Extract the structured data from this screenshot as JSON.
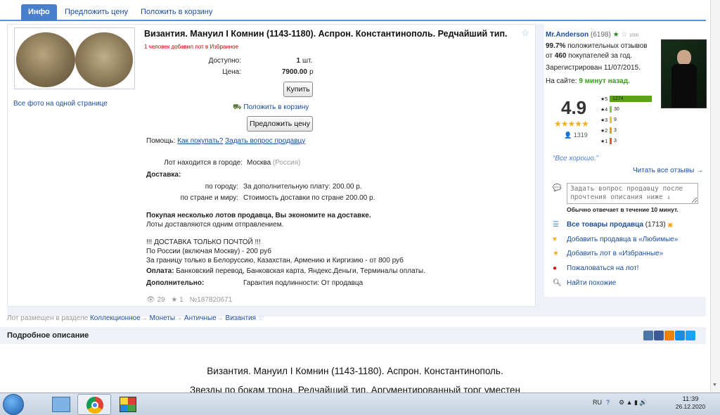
{
  "tabs": [
    {
      "label": "Инфо"
    },
    {
      "label": "Предложить цену"
    },
    {
      "label": "Положить в корзину"
    }
  ],
  "lot": {
    "title": "Византия. Мануил I Комнин (1143-1180). Аспрон. Константинополь. Редчайший тип.",
    "fav_note": "1 человек добавил лот в Избранное",
    "all_photos": "Все фото на одной странице",
    "available_label": "Доступно:",
    "available_value": "1",
    "available_unit": "шт.",
    "price_label": "Цена:",
    "price_value": "7900.00",
    "price_unit": "р",
    "buy_button": "Купить",
    "cart_link": "Положить в корзину",
    "offer_button": "Предложить цену",
    "help_label": "Помощь:",
    "help_how": "Как покупать?",
    "help_ask": "Задать вопрос продавцу",
    "city_label": "Лот находится в городе:",
    "city": "Москва",
    "country": "(Россия)",
    "delivery_label": "Доставка:",
    "city_delivery_label": "по городу:",
    "city_delivery_value": "За дополнительную плату: 200.00 р.",
    "world_delivery_label": "по стране и миру:",
    "world_delivery_value": "Стоимость доставки по стране 200.00 р.",
    "save_title": "Покупая несколько лотов продавца, Вы экономите на доставке.",
    "save_text": "Лоты доставляются одним отправлением.",
    "post_line1": "!!! ДОСТАВКА ТОЛЬКО ПОЧТОЙ !!!",
    "post_line2": "По России (включая Москву) - 200 руб",
    "post_line3": "За границу только в Белоруссию, Казахстан, Армению и Киргизию - от 800 руб",
    "payment_label": "Оплата:",
    "payment_value": "Банковский перевод, Банковская карта, Яндекс.Деньги, Терминалы оплаты.",
    "extra_label": "Дополнительно:",
    "extra_value": "Гарантия подлинности: От продавца",
    "views": "29",
    "stars": "1",
    "lot_number": "№187820671"
  },
  "seller": {
    "name": "Mr.Anderson",
    "rating_count": "(6198)",
    "badge": "1000",
    "positive_pct": "99.7%",
    "positive_text": "положительных отзывов",
    "from_text": "от",
    "buyers": "460",
    "buyers_text": "покупателей за год.",
    "registered": "Зарегистрирован 11/07/2015.",
    "online_label": "На сайте:",
    "online_value": "9 минут назад.",
    "score": "4.9",
    "votes": "1319",
    "bars": [
      {
        "stars": "5",
        "count": "1274",
        "fraction": 1.0,
        "color": "#5aa317"
      },
      {
        "stars": "4",
        "count": "30",
        "fraction": 0.024,
        "color": "#8cc63f"
      },
      {
        "stars": "3",
        "count": "9",
        "fraction": 0.007,
        "color": "#e9c32b"
      },
      {
        "stars": "2",
        "count": "3",
        "fraction": 0.003,
        "color": "#f39c12"
      },
      {
        "stars": "1",
        "count": "3",
        "fraction": 0.003,
        "color": "#e5533c"
      }
    ],
    "quote": "“Все хорошо.”",
    "read_reviews": "Читать все отзывы →",
    "ask_placeholder": "Задать вопрос продавцу после прочтения описания ниже ↓",
    "response_time": "Обычно отвечает в течение 10 минут.",
    "all_goods_label": "Все товары продавца",
    "all_goods_count": "(1713)",
    "add_seller": "Добавить продавца в «Любимые»",
    "add_lot": "Добавить лот в «Избранные»",
    "complain": "Пожаловаться на лот!",
    "similar": "Найти похожие"
  },
  "breadcrumb": {
    "prefix": "Лот размещен в разделе",
    "items": [
      "Коллекционное",
      "Монеты",
      "Античные",
      "Византия"
    ],
    "arrow": "→"
  },
  "description": {
    "header": "Подробное описание",
    "line1": "Византия. Мануил I Комнин (1143-1180). Аспрон. Константинополь.",
    "line2": "Звезды по бокам трона. Редчайший тип. Аргументированный торг уместен"
  },
  "share": [
    {
      "label": "vk",
      "color": "#4a76a8"
    },
    {
      "label": "f",
      "color": "#3b5998"
    },
    {
      "label": "ok",
      "color": "#ee8208"
    },
    {
      "label": "mail",
      "color": "#168de2"
    },
    {
      "label": "tw",
      "color": "#1da1f2"
    }
  ],
  "taskbar": {
    "lang": "RU",
    "time": "11:39",
    "date": "26.12.2020"
  }
}
